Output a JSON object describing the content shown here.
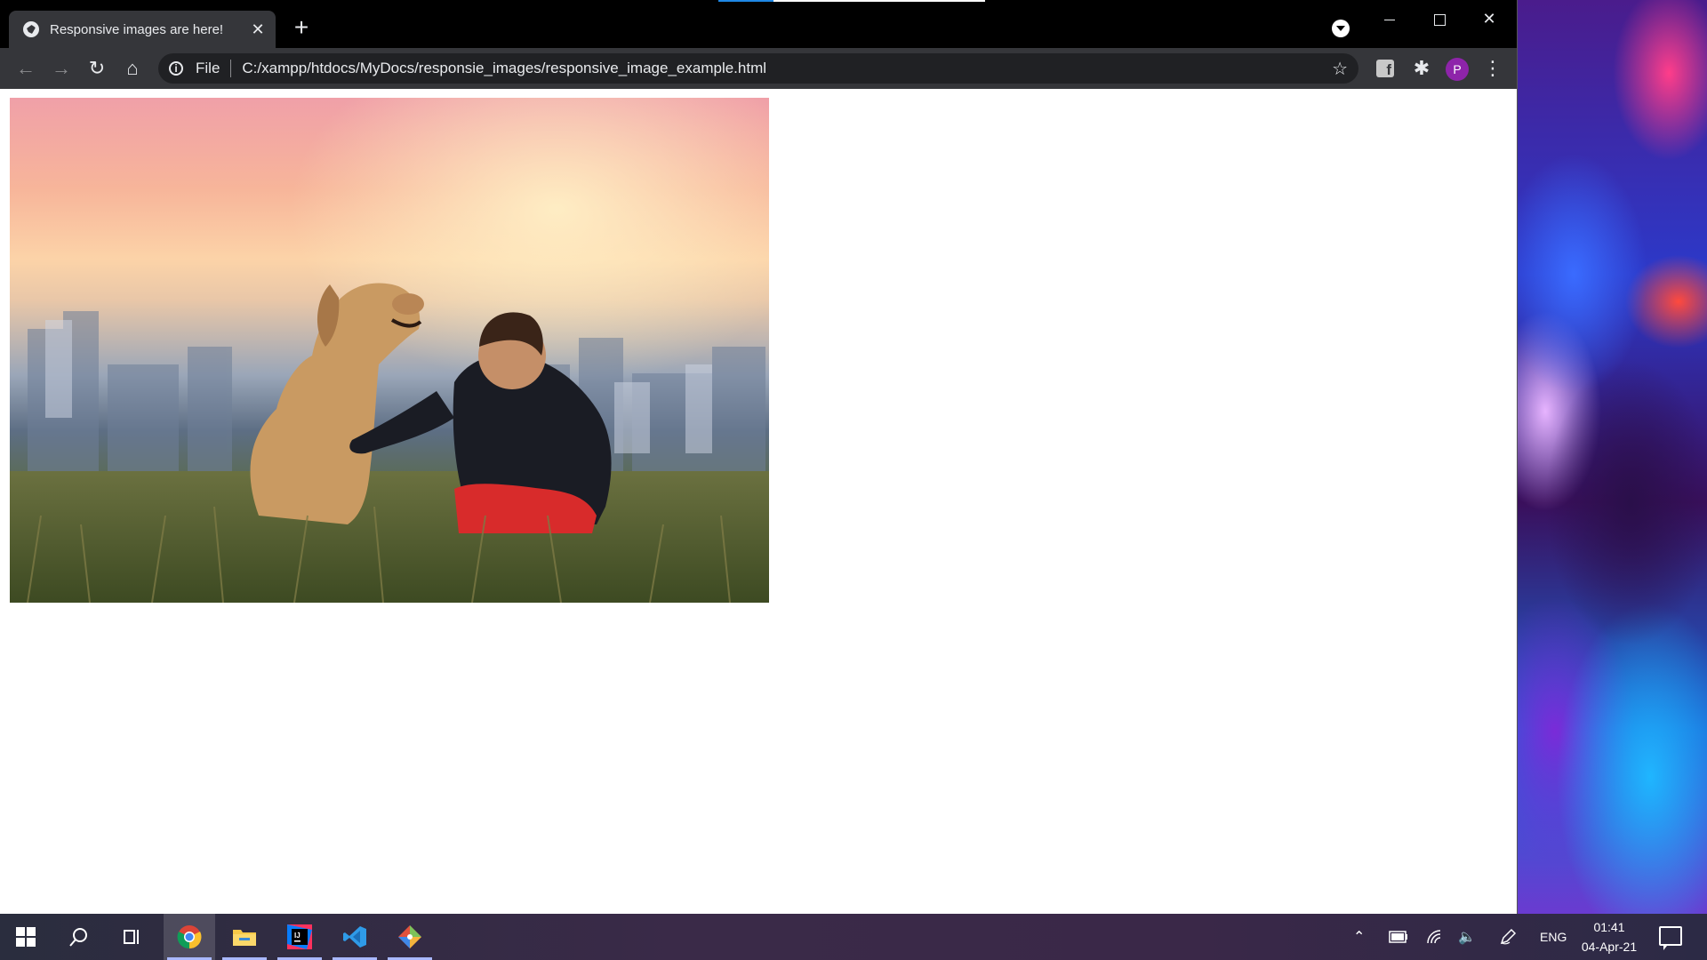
{
  "browser": {
    "tab": {
      "title": "Responsive images are here!",
      "close_glyph": "✕"
    },
    "new_tab_glyph": "+",
    "window_controls": {
      "close_glyph": "✕"
    },
    "toolbar": {
      "back_glyph": "←",
      "forward_glyph": "→",
      "reload_glyph": "↻",
      "home_glyph": "⌂",
      "omnibox": {
        "info_glyph": "i",
        "scheme_label": "File",
        "url": "C:/xampp/htdocs/MyDocs/responsie_images/responsive_image_example.html",
        "bookmark_glyph": "☆"
      },
      "facebook_ext_glyph": "f",
      "extensions_glyph": "✱",
      "profile_initial": "P",
      "menu_glyph": "⋮"
    }
  },
  "page": {
    "image": {
      "icon": "photo-man-with-dog"
    }
  },
  "taskbar": {
    "apps": [
      "start-icon",
      "search-icon",
      "task-view-icon",
      "chrome-icon",
      "file-explorer-icon",
      "intellij-icon",
      "vscode-icon",
      "git-icon"
    ],
    "tray": {
      "chevron_glyph": "⌃",
      "volume_glyph": "🔈",
      "language": "ENG",
      "time": "01:41",
      "date": "04-Apr-21"
    }
  },
  "colors": {
    "titlebar": "#000000",
    "toolbar": "#35363a",
    "omnibox": "#202124",
    "avatar": "#8e24aa",
    "page_background": "#ffffff"
  }
}
